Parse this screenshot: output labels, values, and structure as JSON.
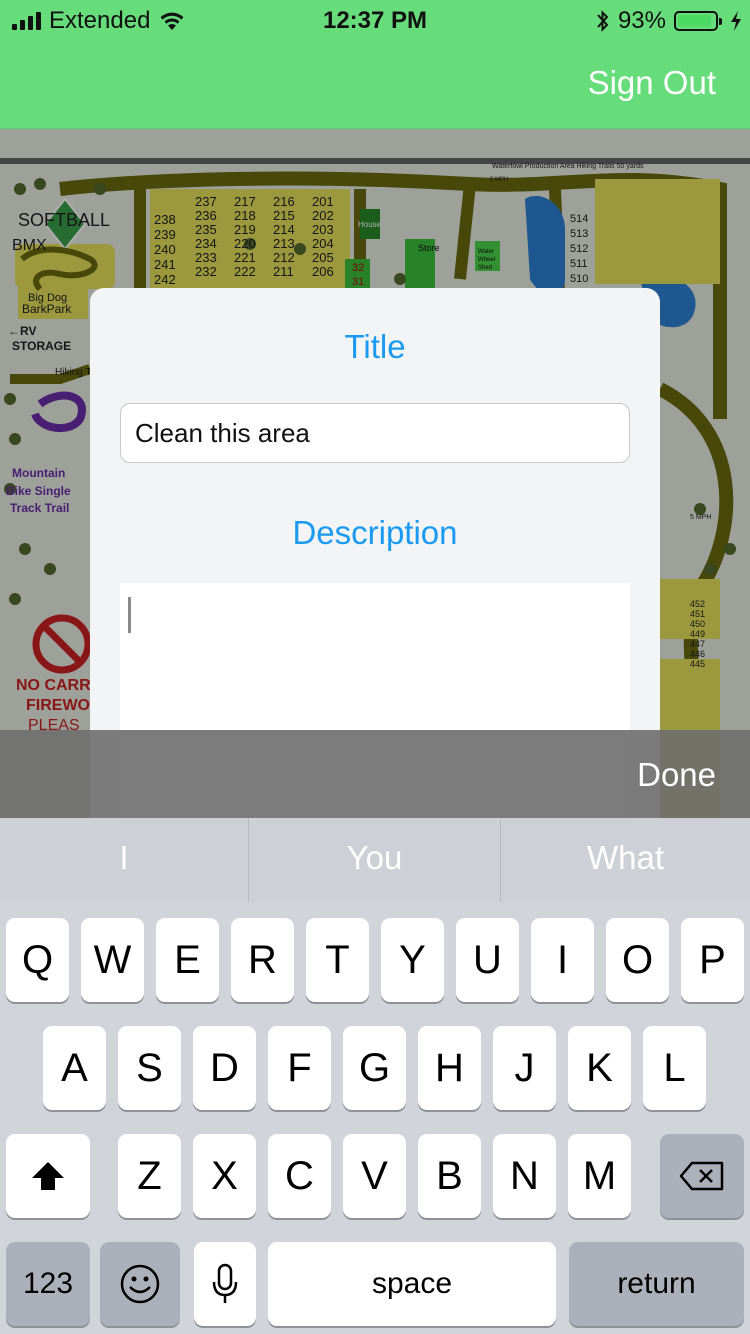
{
  "status_bar": {
    "carrier": "Extended",
    "time": "12:37 PM",
    "battery_percent": "93%",
    "battery_level": 0.93,
    "icons": [
      "signal-icon",
      "wifi-icon",
      "bluetooth-icon",
      "battery-icon",
      "charging-icon"
    ]
  },
  "nav": {
    "sign_out_label": "Sign Out",
    "bar_color": "#66DD7A"
  },
  "map": {
    "labels": {
      "softball": "SOFTBALL",
      "bmx": "BMX",
      "bark_park_1": "Big Dog",
      "bark_park_2": "BarkPark",
      "rv_1": "←RV",
      "rv_2": "STORAGE",
      "hiking": "Hiking T",
      "mountain_1": "Mountain",
      "mountain_2": "Bike Single",
      "mountain_3": "Track Trail",
      "no_carry_1": "NO CARR",
      "no_carry_2": "FIREWO",
      "no_carry_3": "PLEAS",
      "house": "House",
      "store": "Store",
      "water_wheel_1": "Water",
      "water_wheel_2": "Wheel",
      "water_wheel_3": "Shed",
      "waterfowl": "Waterfowl Production Area Hiking Trails 50 yards",
      "mph_top": "5 MPH",
      "mph_right": "5 MPH"
    },
    "sites_col1": [
      "238",
      "239",
      "240",
      "241",
      "242"
    ],
    "sites_col2": [
      "237",
      "236",
      "235",
      "234",
      "233",
      "232"
    ],
    "sites_col3": [
      "217",
      "218",
      "219",
      "220",
      "221",
      "222"
    ],
    "sites_col4": [
      "216",
      "215",
      "214",
      "213",
      "212",
      "211"
    ],
    "sites_col5": [
      "201",
      "202",
      "203",
      "204",
      "205",
      "206"
    ],
    "sites_col6": [
      "32",
      "31"
    ],
    "sites_right": [
      "514",
      "513",
      "512",
      "511",
      "510"
    ],
    "sites_lower_right": [
      "452",
      "451",
      "450",
      "449",
      "447",
      "446",
      "445"
    ]
  },
  "modal": {
    "title_label": "Title",
    "title_value": "Clean this area",
    "description_label": "Description",
    "description_value": "",
    "label_color": "#1A9AF0"
  },
  "toolbar": {
    "done_label": "Done"
  },
  "keyboard": {
    "suggestions": [
      "I",
      "You",
      "What"
    ],
    "row1": [
      "Q",
      "W",
      "E",
      "R",
      "T",
      "Y",
      "U",
      "I",
      "O",
      "P"
    ],
    "row2": [
      "A",
      "S",
      "D",
      "F",
      "G",
      "H",
      "J",
      "K",
      "L"
    ],
    "row3": [
      "Z",
      "X",
      "C",
      "V",
      "B",
      "N",
      "M"
    ],
    "numbers_label": "123",
    "space_label": "space",
    "return_label": "return",
    "shift_icon": "shift-icon",
    "backspace_icon": "backspace-icon",
    "emoji_icon": "emoji-icon",
    "mic_icon": "microphone-icon"
  }
}
